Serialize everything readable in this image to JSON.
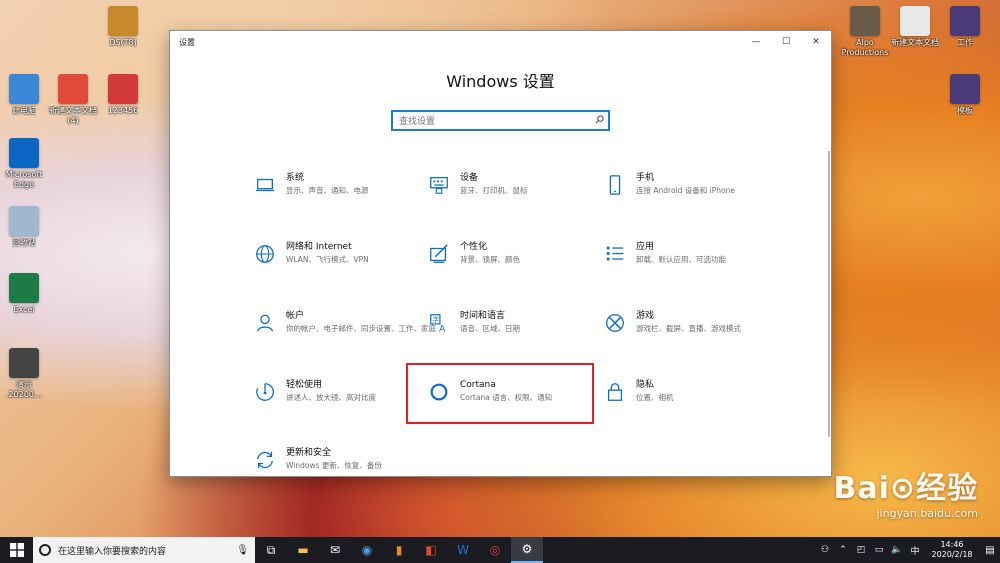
{
  "desktop": {
    "icons_left": [
      {
        "label": "此电脑",
        "color": "#3a87d6"
      },
      {
        "label": "Microsoft Edge",
        "color": "#0a66c2"
      },
      {
        "label": "回收站",
        "color": "#9fb8cf"
      },
      {
        "label": "Excel",
        "color": "#1d7b45"
      },
      {
        "label": "演示 .20200…",
        "color": "#444444"
      }
    ],
    "icons_mid": [
      {
        "label": "DS(T8)",
        "color": "#c98a2e"
      },
      {
        "label": "新建文本文档 (4)",
        "color": "#e04a3a"
      },
      {
        "label": "123456",
        "color": "#d23a3a"
      }
    ],
    "icons_right": [
      {
        "label": "Alpo Productions",
        "color": "#6a5a4a"
      },
      {
        "label": "新建文本文档",
        "color": "#e8e8e8"
      },
      {
        "label": "工作",
        "color": "#4a3a7a"
      },
      {
        "label": "模板",
        "color": "#4a3a7a"
      }
    ]
  },
  "window": {
    "title": "设置",
    "heading": "Windows 设置",
    "controls": {
      "minimize": "—",
      "maximize": "☐",
      "close": "✕"
    },
    "search_placeholder": "查找设置",
    "search_icon": "search-icon",
    "accent": "#0a6cc9",
    "highlight_color": "#e02222",
    "tiles": [
      {
        "key": "system",
        "name": "系统",
        "desc": "显示、声音、通知、电源",
        "icon": "laptop-icon"
      },
      {
        "key": "devices",
        "name": "设备",
        "desc": "蓝牙、打印机、鼠标",
        "icon": "keyboard-icon"
      },
      {
        "key": "phone",
        "name": "手机",
        "desc": "连接 Android 设备和 iPhone",
        "icon": "phone-icon"
      },
      {
        "key": "network",
        "name": "网络和 Internet",
        "desc": "WLAN、飞行模式、VPN",
        "icon": "globe-icon"
      },
      {
        "key": "personalization",
        "name": "个性化",
        "desc": "背景、锁屏、颜色",
        "icon": "paint-icon"
      },
      {
        "key": "apps",
        "name": "应用",
        "desc": "卸载、默认应用、可选功能",
        "icon": "apps-list-icon"
      },
      {
        "key": "accounts",
        "name": "帐户",
        "desc": "你的帐户、电子邮件、同步设置、工作、家庭",
        "icon": "person-icon"
      },
      {
        "key": "time",
        "name": "时间和语言",
        "desc": "语音、区域、日期",
        "icon": "time-language-icon"
      },
      {
        "key": "gaming",
        "name": "游戏",
        "desc": "游戏栏、截屏、直播、游戏模式",
        "icon": "xbox-icon"
      },
      {
        "key": "ease",
        "name": "轻松使用",
        "desc": "讲述人、放大镜、高对比度",
        "icon": "ease-of-access-icon"
      },
      {
        "key": "cortana",
        "name": "Cortana",
        "desc": "Cortana 语言、权限、通知",
        "icon": "cortana-icon"
      },
      {
        "key": "privacy",
        "name": "隐私",
        "desc": "位置、相机",
        "icon": "lock-icon"
      },
      {
        "key": "update",
        "name": "更新和安全",
        "desc": "Windows 更新、恢复、备份",
        "icon": "sync-icon"
      }
    ]
  },
  "taskbar": {
    "search_placeholder": "在这里输入你要搜索的内容",
    "apps": [
      "task-view-icon",
      "file-explorer-icon",
      "mail-icon",
      "browser-icon",
      "app-icon",
      "office-icon",
      "word-icon",
      "netease-music-icon",
      "settings-icon"
    ],
    "time": "14:46",
    "date": "2020/2/18"
  },
  "watermark": {
    "brand": "Bai⊙经验",
    "url": "jingyan.baidu.com"
  }
}
